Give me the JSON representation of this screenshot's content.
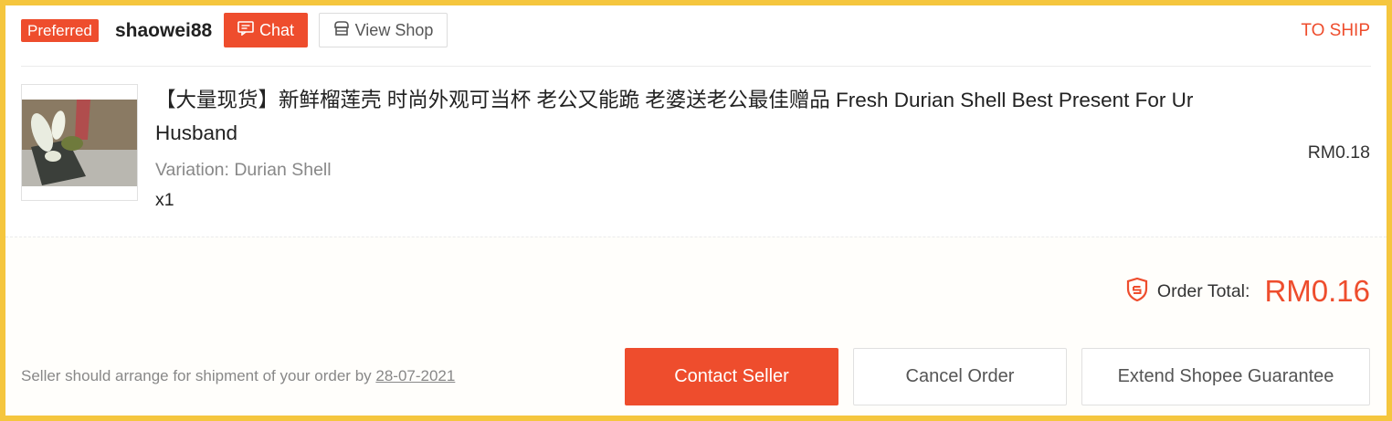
{
  "shop": {
    "badge": "Preferred",
    "name": "shaowei88",
    "chat_label": "Chat",
    "view_shop_label": "View Shop",
    "status": "TO SHIP"
  },
  "item": {
    "title": "【大量现货】新鲜榴莲壳 时尚外观可当杯 老公又能跪 老婆送老公最佳赠品 Fresh Durian Shell Best Present For Ur Husband",
    "variation": "Variation: Durian Shell",
    "quantity": "x1",
    "price": "RM0.18",
    "thumbnail_icon": "durian-shell-photo"
  },
  "summary": {
    "total_label": "Order Total:",
    "total_value": "RM0.16",
    "shield_icon": "shopee-guarantee-shield-icon"
  },
  "shipping": {
    "note_prefix": "Seller should arrange for shipment of your order by ",
    "date": "28-07-2021"
  },
  "actions": {
    "contact_seller": "Contact Seller",
    "cancel_order": "Cancel Order",
    "extend_guarantee": "Extend Shopee Guarantee"
  },
  "colors": {
    "accent": "#ee4d2d",
    "frame": "#f5c63e"
  }
}
